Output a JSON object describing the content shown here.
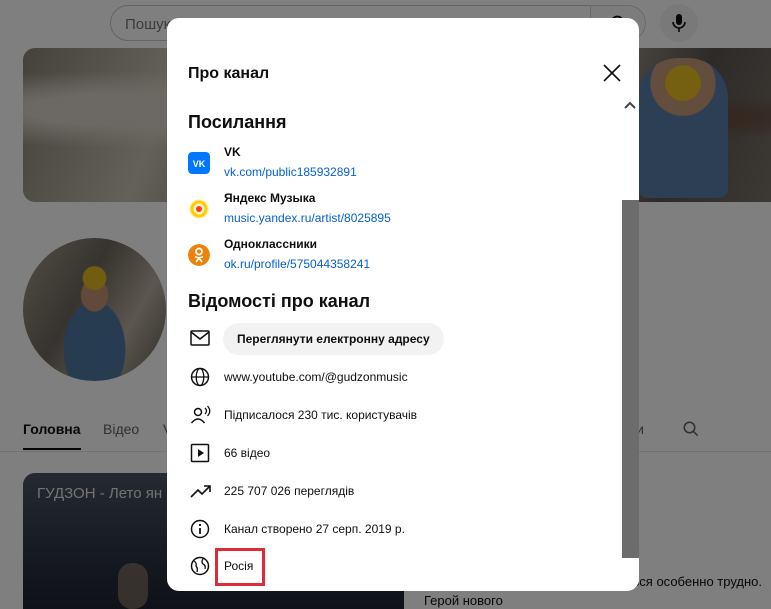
{
  "header": {
    "search_placeholder": "Пошук"
  },
  "channel_tabs": {
    "home": "Головна",
    "videos": "Відео",
    "partial_left": "V",
    "partial_right": "ли"
  },
  "video": {
    "thumbnail_title": "ГУДЗОН - Лето ян",
    "link_fragment": "а",
    "description": "нечто гораздо большее, расставаться особенно трудно. Герой нового"
  },
  "modal": {
    "title": "Про канал",
    "links_heading": "Посилання",
    "links": [
      {
        "name": "VK",
        "url": "vk.com/public185932891",
        "icon": "vk-icon",
        "color": "#0077ff"
      },
      {
        "name": "Яндекс Музыка",
        "url": "music.yandex.ru/artist/8025895",
        "icon": "yandex-music-icon",
        "color": "#ffcc00"
      },
      {
        "name": "Одноклассники",
        "url": "ok.ru/profile/575044358241",
        "icon": "odnoklassniki-icon",
        "color": "#ee8208"
      }
    ],
    "info_heading": "Відомості про канал",
    "email_button": "Переглянути електронну адресу",
    "website": "www.youtube.com/@gudzonmusic",
    "subscribers": "Підписалося 230 тис. користувачів",
    "video_count": "66 відео",
    "views": "225 707 026 переглядів",
    "created": "Канал створено 27 серп. 2019 р.",
    "country": "Росія",
    "highlight_color": "#dd2b3a"
  }
}
